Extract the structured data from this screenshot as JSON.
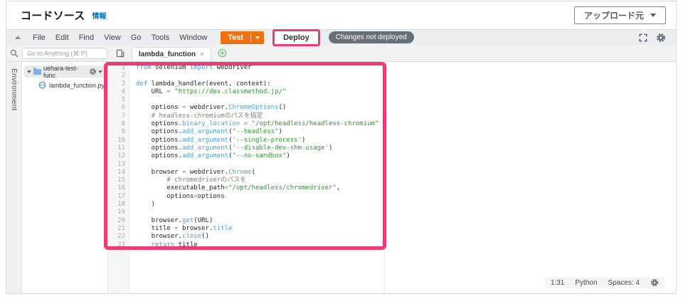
{
  "header": {
    "title": "コードソース",
    "info_link": "情報",
    "upload_button": "アップロード元"
  },
  "menubar": {
    "items": [
      "File",
      "Edit",
      "Find",
      "View",
      "Go",
      "Tools",
      "Window"
    ],
    "test_button": "Test",
    "deploy_button": "Deploy",
    "status_badge": "Changes not deployed"
  },
  "tabbar": {
    "search_placeholder": "Go to Anything (⌘ P)",
    "active_tab": "lambda_function",
    "close_glyph": "×"
  },
  "explorer": {
    "panel_label": "Environment",
    "root_folder": "uehara-test-func",
    "file": "lambda_function.py"
  },
  "editor": {
    "lines": [
      [
        [
          "k",
          "from"
        ],
        [
          "p",
          " selenium "
        ],
        [
          "k",
          "import"
        ],
        [
          "p",
          " webdriver"
        ]
      ],
      [],
      [
        [
          "k",
          "def"
        ],
        [
          "p",
          " lambda_handler(event, context):"
        ]
      ],
      [
        [
          "p",
          "    URL "
        ],
        [
          "o",
          "="
        ],
        [
          "p",
          " "
        ],
        [
          "s",
          "\"https://dev.classmethod.jp/\""
        ]
      ],
      [],
      [
        [
          "p",
          "    options "
        ],
        [
          "o",
          "="
        ],
        [
          "p",
          " webdriver."
        ],
        [
          "f",
          "ChromeOptions"
        ],
        [
          "p",
          "()"
        ]
      ],
      [
        [
          "c",
          "    # headless-chromiumのパスを指定"
        ]
      ],
      [
        [
          "p",
          "    options."
        ],
        [
          "f",
          "binary_location"
        ],
        [
          "p",
          " "
        ],
        [
          "o",
          "="
        ],
        [
          "p",
          " "
        ],
        [
          "s",
          "\"/opt/headless/headless-chromium\""
        ]
      ],
      [
        [
          "p",
          "    options."
        ],
        [
          "f",
          "add_argument"
        ],
        [
          "p",
          "("
        ],
        [
          "s",
          "\"--headless\""
        ],
        [
          "p",
          ")"
        ]
      ],
      [
        [
          "p",
          "    options."
        ],
        [
          "f",
          "add_argument"
        ],
        [
          "p",
          "("
        ],
        [
          "s",
          "'--single-process'"
        ],
        [
          "p",
          ")"
        ]
      ],
      [
        [
          "p",
          "    options."
        ],
        [
          "f",
          "add_argument"
        ],
        [
          "p",
          "("
        ],
        [
          "s",
          "'--disable-dev-shm-usage'"
        ],
        [
          "p",
          ")"
        ]
      ],
      [
        [
          "p",
          "    options."
        ],
        [
          "f",
          "add_argument"
        ],
        [
          "p",
          "("
        ],
        [
          "s",
          "\"--no-sandbox\""
        ],
        [
          "p",
          ")"
        ]
      ],
      [],
      [
        [
          "p",
          "    browser "
        ],
        [
          "o",
          "="
        ],
        [
          "p",
          " webdriver."
        ],
        [
          "f",
          "Chrome"
        ],
        [
          "p",
          "("
        ]
      ],
      [
        [
          "c",
          "        # chromedriverのパスを"
        ]
      ],
      [
        [
          "p",
          "        executable_path"
        ],
        [
          "o",
          "="
        ],
        [
          "s",
          "\"/opt/headless/chromedriver\""
        ],
        [
          "p",
          ","
        ]
      ],
      [
        [
          "p",
          "        options"
        ],
        [
          "o",
          "="
        ],
        [
          "p",
          "options"
        ]
      ],
      [
        [
          "p",
          "    )"
        ]
      ],
      [],
      [
        [
          "p",
          "    browser."
        ],
        [
          "f",
          "get"
        ],
        [
          "p",
          "(URL)"
        ]
      ],
      [
        [
          "p",
          "    title "
        ],
        [
          "o",
          "="
        ],
        [
          "p",
          " browser."
        ],
        [
          "f",
          "title"
        ]
      ],
      [
        [
          "p",
          "    browser."
        ],
        [
          "f",
          "close"
        ],
        [
          "p",
          "()"
        ]
      ],
      [
        [
          "p",
          "    "
        ],
        [
          "k",
          "return"
        ],
        [
          "p",
          " title"
        ]
      ]
    ]
  },
  "statusbar": {
    "cursor": "1:31",
    "language": "Python",
    "spaces": "Spaces: 4"
  },
  "colors": {
    "aws_orange": "#ec7211",
    "annotation_pink": "#ef3a76",
    "link_blue": "#0073bb",
    "badge_gray": "#687078",
    "keyword_blue": "#4596d3",
    "string_green": "#2f9a2f",
    "comment_gray": "#7b837b"
  }
}
